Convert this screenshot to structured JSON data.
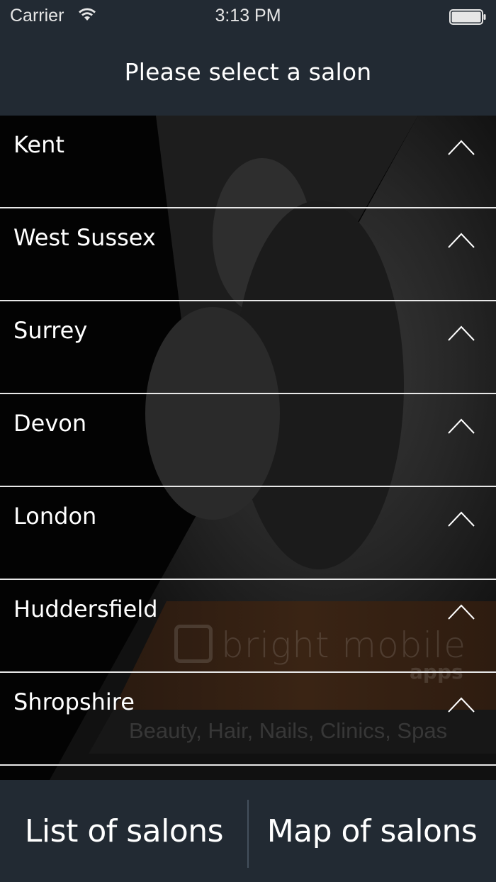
{
  "status_bar": {
    "carrier": "Carrier",
    "time": "3:13 PM",
    "wifi_icon": "wifi-icon",
    "battery_icon": "battery-icon"
  },
  "nav": {
    "title": "Please select a salon"
  },
  "regions": [
    {
      "label": "Kent",
      "icon": "chevron-up-icon"
    },
    {
      "label": "West Sussex",
      "icon": "chevron-up-icon"
    },
    {
      "label": "Surrey",
      "icon": "chevron-up-icon"
    },
    {
      "label": "Devon",
      "icon": "chevron-up-icon"
    },
    {
      "label": "London",
      "icon": "chevron-up-icon"
    },
    {
      "label": "Huddersfield",
      "icon": "chevron-up-icon"
    },
    {
      "label": "Shropshire",
      "icon": "chevron-up-icon"
    }
  ],
  "watermark": {
    "brand": "bright mobile",
    "apps": "apps",
    "tagline": "Beauty, Hair, Nails, Clinics, Spas"
  },
  "toolbar": {
    "list_label": "List of salons",
    "map_label": "Map of salons"
  },
  "colors": {
    "bar_background": "#222a33",
    "row_divider": "#e8e8e8",
    "text": "#ffffff"
  }
}
